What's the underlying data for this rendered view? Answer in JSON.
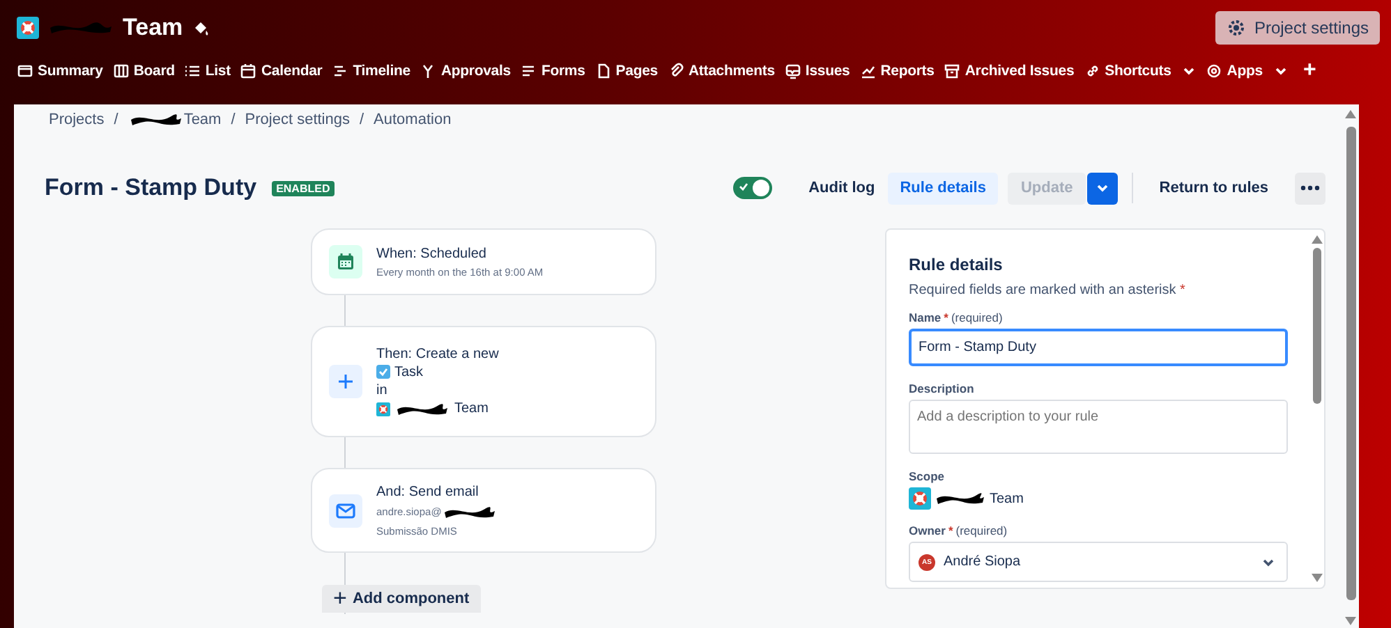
{
  "header": {
    "title": "Team",
    "button": "Project settings"
  },
  "nav": [
    {
      "label": "Summary",
      "kind": "window",
      "menu": false
    },
    {
      "label": "Board",
      "kind": "columns",
      "menu": false
    },
    {
      "label": "List",
      "kind": "lines",
      "menu": false
    },
    {
      "label": "Calendar",
      "kind": "calendar",
      "menu": false
    },
    {
      "label": "Timeline",
      "kind": "timeline",
      "menu": false
    },
    {
      "label": "Approvals",
      "kind": "branch",
      "menu": false
    },
    {
      "label": "Forms",
      "kind": "form",
      "menu": false
    },
    {
      "label": "Pages",
      "kind": "page",
      "menu": false
    },
    {
      "label": "Attachments",
      "kind": "clip",
      "menu": false
    },
    {
      "label": "Issues",
      "kind": "tray",
      "menu": false
    },
    {
      "label": "Reports",
      "kind": "chart",
      "menu": false
    },
    {
      "label": "Archived Issues",
      "kind": "archive",
      "menu": false
    },
    {
      "label": "Shortcuts",
      "kind": "link",
      "menu": true
    },
    {
      "label": "Apps",
      "kind": "gear",
      "menu": true
    }
  ],
  "nav_add": "+",
  "breadcrumbs": [
    {
      "label": "Projects",
      "redacted": false,
      "separator": "/"
    },
    {
      "label": "Team",
      "redacted": true,
      "separator": "/"
    },
    {
      "label": "Project settings",
      "redacted": false,
      "separator": "/"
    },
    {
      "label": "Automation",
      "redacted": false
    }
  ],
  "rule": {
    "title": "Form - Stamp Duty",
    "status": "ENABLED",
    "enabled": true,
    "audit": "Audit log",
    "details": "Rule details",
    "details_selected": true,
    "update": "Update",
    "update_disabled": true,
    "return": "Return to rules"
  },
  "flow": {
    "steps": [
      {
        "kind": "trigger",
        "title": "When: Scheduled",
        "lines": [
          {
            "text": "Every month on the 16th at 9:00 AM",
            "redacted": false
          }
        ]
      },
      {
        "kind": "create",
        "title": "Then: Create a new",
        "issue_type": "Task",
        "connector": "in",
        "project": "Team"
      },
      {
        "kind": "email",
        "title": "And: Send email",
        "lines": [
          {
            "text": "andre.siopa@",
            "redacted": true
          },
          {
            "text": "Submissão DMIS",
            "redacted": false
          }
        ]
      }
    ],
    "add": "+",
    "add_label": "Add component"
  },
  "details": {
    "title": "Rule details",
    "note": "Required fields are marked with an asterisk",
    "note_mark": "*",
    "fields": [
      {
        "kind": "text",
        "label": "Name",
        "mark": "*",
        "hint": "(required)",
        "value": "Form - Stamp Duty",
        "focused": true
      },
      {
        "kind": "textarea",
        "label": "Description",
        "placeholder": "Add a description to your rule",
        "focused": false
      },
      {
        "kind": "scope",
        "label": "Scope",
        "value": "Team"
      },
      {
        "kind": "select",
        "label": "Owner",
        "mark": "*",
        "hint": "(required)",
        "value": "André Siopa",
        "initials": "AS"
      }
    ]
  }
}
